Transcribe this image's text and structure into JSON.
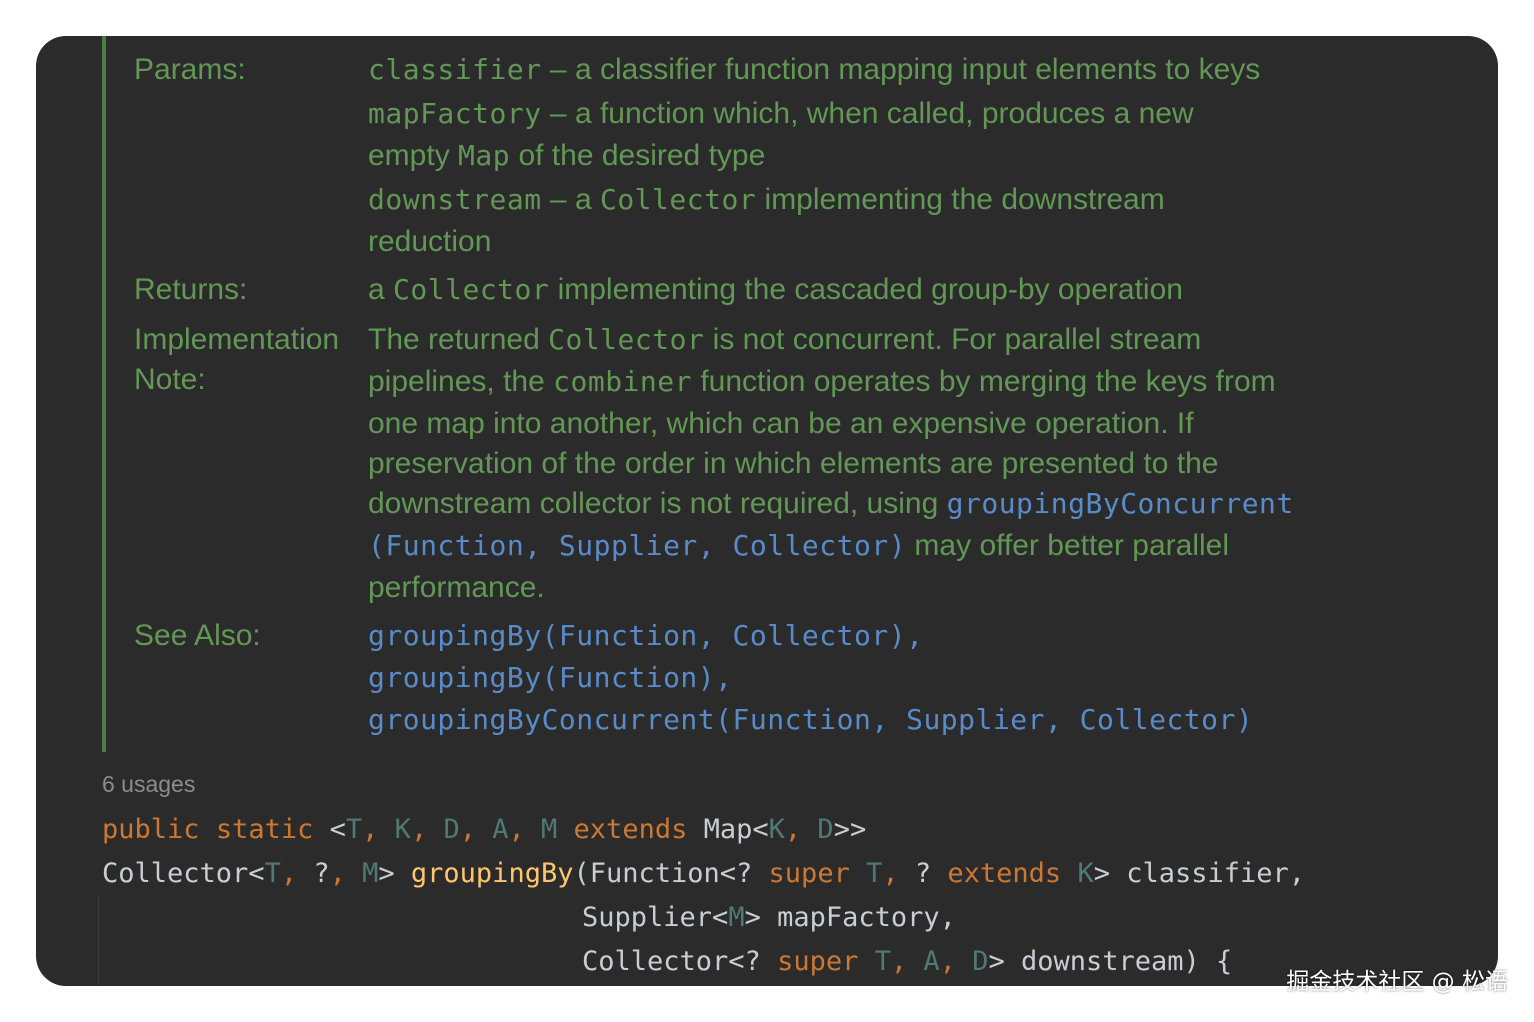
{
  "doc": {
    "params_label": "Params:",
    "params": [
      {
        "name": "classifier",
        "dash": " – ",
        "desc": "a classifier function mapping input elements to keys"
      },
      {
        "name": "mapFactory",
        "dash": " – ",
        "desc": "a function which, when called, produces a new"
      },
      {
        "pre": "empty ",
        "code": "Map",
        "post": " of the desired type"
      },
      {
        "name": "downstream",
        "dash": " – ",
        "pre": "a ",
        "code": "Collector",
        "post": " implementing the downstream"
      },
      {
        "text": "reduction"
      }
    ],
    "returns_label": "Returns:",
    "returns": {
      "pre": "a ",
      "code": "Collector",
      "post": " implementing the cascaded group-by operation"
    },
    "impl_label_1": "Implementation",
    "impl_label_2": "Note:",
    "impl": {
      "l1_pre": "The returned ",
      "l1_code": "Collector",
      "l1_post": " is not concurrent. For parallel stream",
      "l2_pre": "pipelines, the ",
      "l2_code": "combiner",
      "l2_post": " function operates by merging the keys from",
      "l3": "one map into another, which can be an expensive operation. If",
      "l4": "preservation of the order in which elements are presented to the",
      "l5_pre": "downstream collector is not required, using ",
      "l5_link": "groupingByConcurrent",
      "l6_link": "(Function, Supplier, Collector)",
      "l6_post": " may offer better parallel",
      "l7": "performance."
    },
    "see_also_label": "See Also:",
    "see_also": [
      "groupingBy(Function, Collector),",
      "groupingBy(Function),",
      "groupingByConcurrent(Function, Supplier, Collector)"
    ]
  },
  "usages": "6 usages",
  "code": {
    "line1": {
      "kw1": "public",
      "kw2": "static",
      "open": "<",
      "T": "T",
      "K": "K",
      "D": "D",
      "A": "A",
      "M": "M",
      "extends": "extends",
      "map": "Map<",
      "close": ">>"
    },
    "line2": {
      "collector": "Collector<",
      "T": "T",
      "q": "?",
      "M": "M",
      "fn": "groupingBy",
      "function": "(Function<? ",
      "super": "super",
      "T2": "T",
      "q2": "? ",
      "extends": "extends",
      "K": "K",
      "param": "> classifier,"
    },
    "line3": {
      "supplier": "Supplier<",
      "M": "M",
      "param": "> mapFactory,"
    },
    "line4": {
      "collector": "Collector<? ",
      "super": "super",
      "T": "T",
      "A": "A",
      "D": "D",
      "param": "> downstream) {"
    }
  },
  "watermark": "掘金技术社区 @ 松语",
  "colors": {
    "background": "#2b2b2c",
    "doc_text": "#629755",
    "link": "#5a8bc9",
    "keyword": "#cc7832",
    "type_param": "#507874",
    "function": "#ffc66d"
  }
}
